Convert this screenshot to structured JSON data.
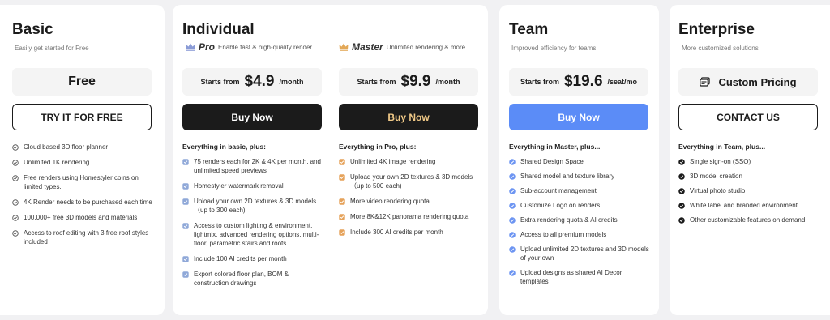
{
  "basic": {
    "title": "Basic",
    "subtitle": "Easily get started for Free",
    "price_label": "Free",
    "button_label": "TRY IT FOR FREE",
    "features": [
      "Cloud based 3D floor planner",
      "Unlimited 1K rendering",
      "Free renders using Homestyler coins on limited types.",
      "4K Render needs to be purchased each time",
      "100,000+ free 3D models and materials",
      "Access to roof editing with 3 free roof styles included"
    ]
  },
  "individual": {
    "title": "Individual",
    "pro": {
      "name": "Pro",
      "desc": "Enable fast & high-quality render",
      "price_prefix": "Starts from",
      "price": "$4.9",
      "unit": "/month",
      "button_label": "Buy Now",
      "features_heading": "Everything in basic, plus:",
      "features": [
        "75 renders each for 2K & 4K per month, and unlimited speed previews",
        "Homestyler watermark removal",
        "Upload your own 2D textures & 3D models（up to 300 each)",
        "Access to custom lighting & environment, lightmix, advanced rendering options, multi-floor, parametric stairs and roofs",
        "Include 100 AI credits per month",
        "Export colored floor plan, BOM & construction drawings"
      ]
    },
    "master": {
      "name": "Master",
      "desc": "Unlimited rendering & more",
      "price_prefix": "Starts from",
      "price": "$9.9",
      "unit": "/month",
      "button_label": "Buy Now",
      "features_heading": "Everything in Pro, plus:",
      "features": [
        "Unlimited 4K image rendering",
        "Upload your own 2D textures & 3D models（up to 500 each)",
        "More video rendering quota",
        "More 8K&12K panorama rendering quota",
        "Include 300 AI credits per month"
      ]
    }
  },
  "team": {
    "title": "Team",
    "subtitle": "Improved efficiency for teams",
    "price_prefix": "Starts from",
    "price": "$19.6",
    "unit": "/seat/mo",
    "button_label": "Buy Now",
    "features_heading": "Everything in Master, plus...",
    "features": [
      "Shared Design Space",
      "Shared model and texture library",
      "Sub-account management",
      "Customize Logo on renders",
      "Extra rendering quota & AI credits",
      "Access to all premium models",
      "Upload unlimited 2D textures and 3D models of your own",
      "Upload designs as shared AI Decor templates"
    ]
  },
  "enterprise": {
    "title": "Enterprise",
    "subtitle": "More customized solutions",
    "price_label": "Custom Pricing",
    "button_label": "CONTACT US",
    "features_heading": "Everything in Team, plus...",
    "features": [
      "Single sign-on (SSO)",
      "3D model creation",
      "Virtual photo studio",
      "White label and branded environment",
      "Other customizable features on demand"
    ]
  },
  "colors": {
    "pro_crown": "#8a9bd6",
    "master_crown": "#e3a857",
    "team_check": "#6d95f2",
    "pro_check": "#8fa8d8",
    "master_check": "#e5a25a",
    "buy_dark": "#1b1b1b",
    "buy_blue": "#5b8cf7"
  },
  "icons": {
    "basic_feature": "circle-check-outline-icon",
    "pro_feature": "square-check-icon",
    "master_feature": "square-check-icon",
    "team_feature": "circle-check-filled-icon",
    "enterprise_feature": "circle-check-filled-icon",
    "pro_tier": "crown-icon",
    "master_tier": "crown-icon",
    "custom_pricing": "price-card-icon"
  }
}
